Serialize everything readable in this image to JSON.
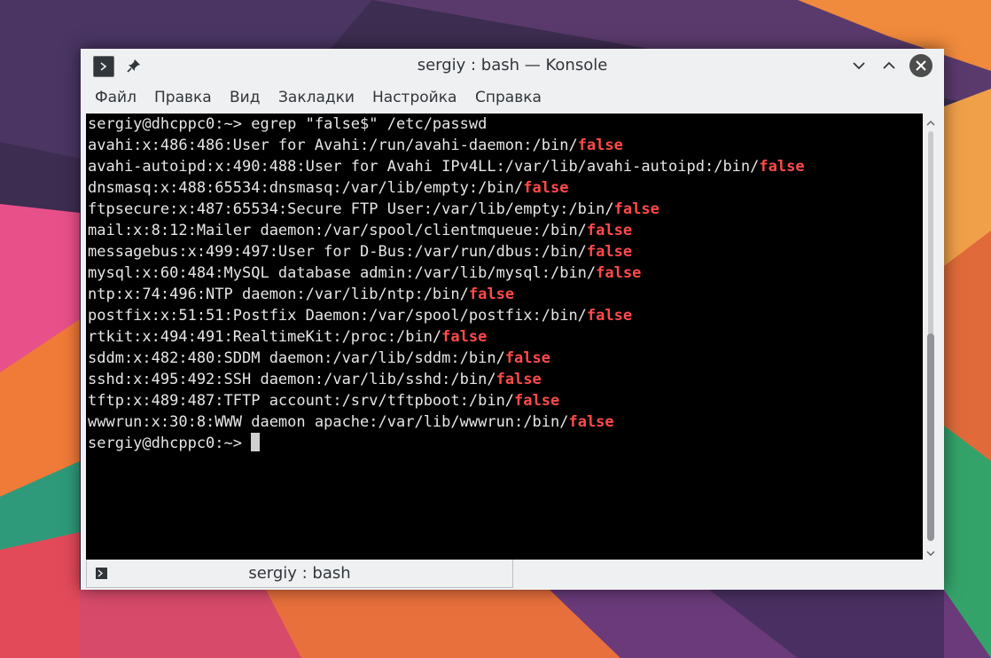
{
  "window": {
    "title": "sergiy : bash — Konsole"
  },
  "menu": [
    "Файл",
    "Правка",
    "Вид",
    "Закладки",
    "Настройка",
    "Справка"
  ],
  "terminal": {
    "lines": [
      {
        "text": "sergiy@dhcppc0:~> egrep \"false$\" /etc/passwd",
        "highlight": ""
      },
      {
        "text": "avahi:x:486:486:User for Avahi:/run/avahi-daemon:/bin/",
        "highlight": "false"
      },
      {
        "text": "avahi-autoipd:x:490:488:User for Avahi IPv4LL:/var/lib/avahi-autoipd:/bin/",
        "highlight": "false"
      },
      {
        "text": "dnsmasq:x:488:65534:dnsmasq:/var/lib/empty:/bin/",
        "highlight": "false"
      },
      {
        "text": "ftpsecure:x:487:65534:Secure FTP User:/var/lib/empty:/bin/",
        "highlight": "false"
      },
      {
        "text": "mail:x:8:12:Mailer daemon:/var/spool/clientmqueue:/bin/",
        "highlight": "false"
      },
      {
        "text": "messagebus:x:499:497:User for D-Bus:/var/run/dbus:/bin/",
        "highlight": "false"
      },
      {
        "text": "mysql:x:60:484:MySQL database admin:/var/lib/mysql:/bin/",
        "highlight": "false"
      },
      {
        "text": "ntp:x:74:496:NTP daemon:/var/lib/ntp:/bin/",
        "highlight": "false"
      },
      {
        "text": "postfix:x:51:51:Postfix Daemon:/var/spool/postfix:/bin/",
        "highlight": "false"
      },
      {
        "text": "rtkit:x:494:491:RealtimeKit:/proc:/bin/",
        "highlight": "false"
      },
      {
        "text": "sddm:x:482:480:SDDM daemon:/var/lib/sddm:/bin/",
        "highlight": "false"
      },
      {
        "text": "sshd:x:495:492:SSH daemon:/var/lib/sshd:/bin/",
        "highlight": "false"
      },
      {
        "text": "tftp:x:489:487:TFTP account:/srv/tftpboot:/bin/",
        "highlight": "false"
      },
      {
        "text": "wwwrun:x:30:8:WWW daemon apache:/var/lib/wwwrun:/bin/",
        "highlight": "false"
      }
    ],
    "prompt": "sergiy@dhcppc0:~> "
  },
  "tab": {
    "label": "sergiy : bash"
  },
  "icons": {
    "app": "terminal-icon",
    "pin": "pin-icon",
    "minimize": "chevron-down-icon",
    "maximize": "chevron-up-icon",
    "close": "close-icon"
  },
  "colors": {
    "terminal_bg": "#000000",
    "terminal_fg": "#e6e6e6",
    "match_highlight": "#ff4a4a",
    "window_bg": "#eff0f1"
  }
}
